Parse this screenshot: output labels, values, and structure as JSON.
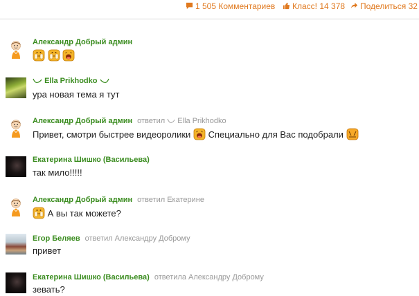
{
  "stats": {
    "comments": "1 505 Комментариев",
    "likes": "Класс! 14 378",
    "shares": "Поделиться 32",
    "accent": "#e0791f"
  },
  "comments": [
    {
      "author": "Александр Добрый админ",
      "reply": "",
      "text": "",
      "smileys": [
        "clapping-smiley",
        "clapping-smiley",
        "laughing-smiley"
      ]
    },
    {
      "author": "Ella Prikhodko",
      "reply": "",
      "text": "ура новая тема я тут"
    },
    {
      "author": "Александр Добрый админ",
      "reply": "ответил",
      "reply_target": "Ella Prikhodko",
      "text": "Привет, смотри быстрее видеоролики",
      "text2": "Специально для Вас подобрали"
    },
    {
      "author": "Екатерина Шишко (Васильева)",
      "reply": "",
      "text": "так мило!!!!!"
    },
    {
      "author": "Александр Добрый админ",
      "reply": "ответил Екатерине",
      "text": "А вы так можете?"
    },
    {
      "author": "Егор Беляев",
      "reply": "ответил Александру Доброму",
      "text": "привет"
    },
    {
      "author": "Екатерина Шишко (Васильева)",
      "reply": "ответила Александру Доброму",
      "text": "зевать?"
    }
  ],
  "colors": {
    "author": "#3a8c1f",
    "muted": "#999999",
    "smiley": "#f4b52a"
  }
}
